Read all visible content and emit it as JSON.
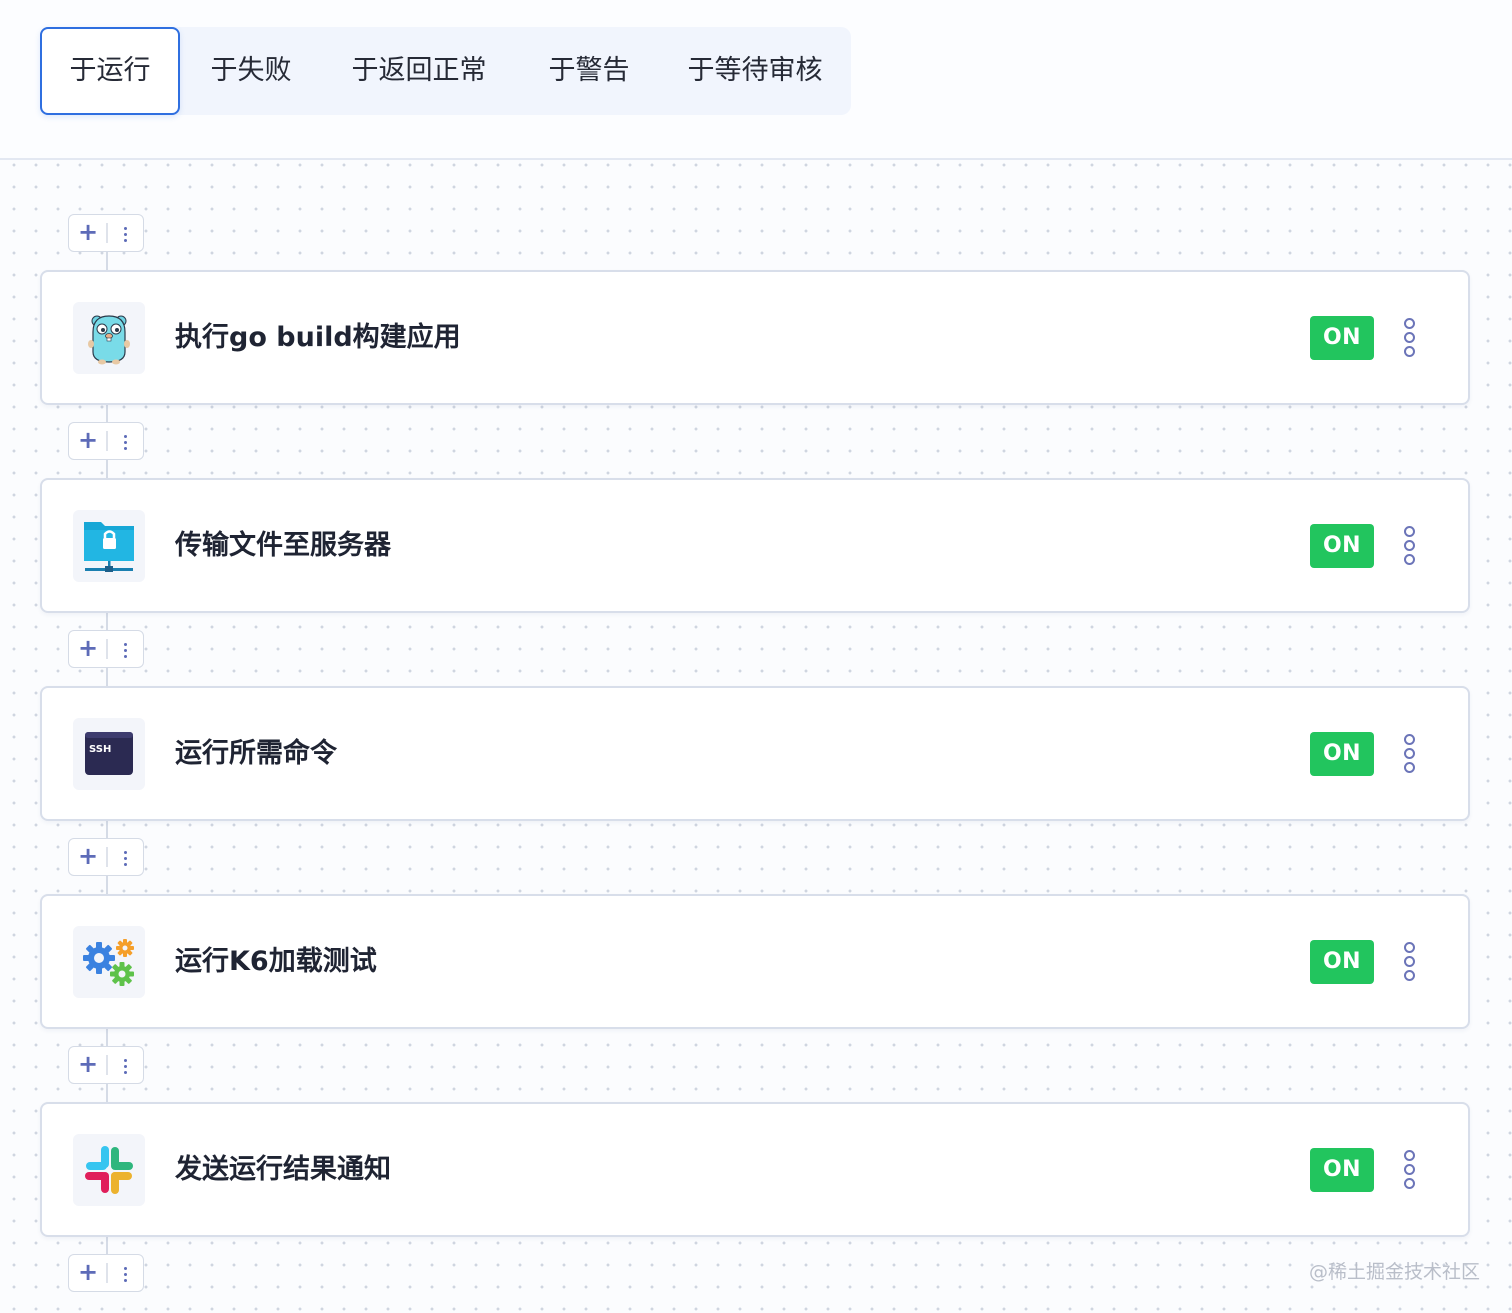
{
  "tabs": [
    {
      "label": "于运行",
      "active": true
    },
    {
      "label": "于失败",
      "active": false
    },
    {
      "label": "于返回正常",
      "active": false
    },
    {
      "label": "于警告",
      "active": false
    },
    {
      "label": "于等待审核",
      "active": false
    }
  ],
  "steps": [
    {
      "title": "执行go build构建应用",
      "status": "ON",
      "icon": "gopher-icon"
    },
    {
      "title": "传输文件至服务器",
      "status": "ON",
      "icon": "sftp-icon"
    },
    {
      "title": "运行所需命令",
      "status": "ON",
      "icon": "ssh-icon"
    },
    {
      "title": "运行K6加载测试",
      "status": "ON",
      "icon": "gears-icon"
    },
    {
      "title": "发送运行结果通知",
      "status": "ON",
      "icon": "slack-icon"
    }
  ],
  "ssh_label": "SSH",
  "add_symbol": "+",
  "watermark": "@稀土掘金技术社区",
  "colors": {
    "accent": "#2f6fe0",
    "on_badge": "#22c55e",
    "icon_purple": "#5d6bb8"
  }
}
